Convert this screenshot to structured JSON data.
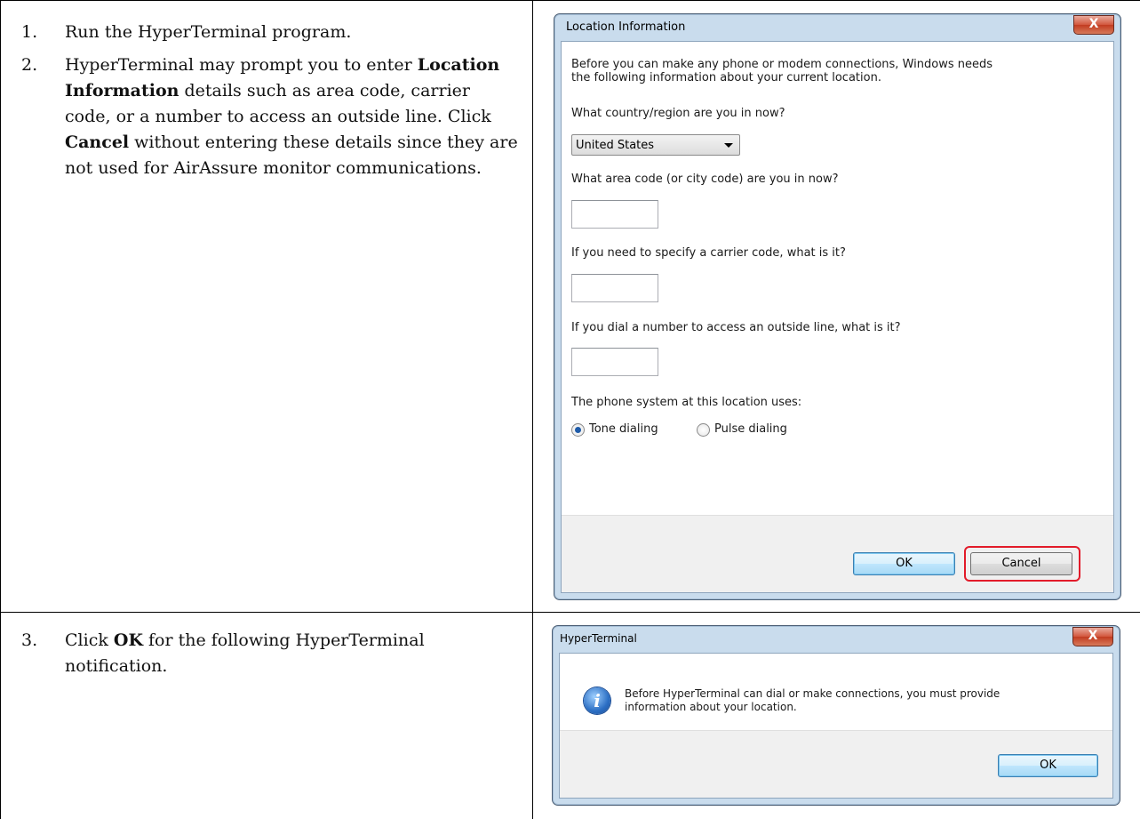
{
  "steps": [
    {
      "number": "1.",
      "text": "Run the HyperTerminal program."
    },
    {
      "number": "2.",
      "t1": "HyperTerminal may prompt you to enter ",
      "b1": "Location Information",
      "t2": " details such as area code, carrier code, or a number to access an outside line. Click ",
      "b2": "Cancel",
      "t3": " without entering these details since they are not used for AirAssure monitor communications."
    },
    {
      "number": "3.",
      "t1": "Click ",
      "b1": "OK",
      "t2": " for the following HyperTerminal notification."
    }
  ],
  "location_dialog": {
    "title": "Location Information",
    "close_glyph": "X",
    "intro_line1": "Before you can make any phone or modem connections, Windows needs",
    "intro_line2": "the following information about your current location.",
    "country_label": "What country/region are you in now?",
    "country_value": "United States",
    "area_code_label": "What area code (or city code) are you in now?",
    "area_code_value": "",
    "carrier_label": "If you need to specify a carrier code, what is it?",
    "carrier_value": "",
    "outside_line_label": "If you dial a number to access an outside line, what is it?",
    "outside_line_value": "",
    "phone_system_label": "The phone system at this location uses:",
    "tone_label": "Tone dialing",
    "pulse_label": "Pulse dialing",
    "selected_dialing": "Tone dialing",
    "ok_label": "OK",
    "cancel_label": "Cancel",
    "highlight_color": "#e21b2a"
  },
  "notification_dialog": {
    "title": "HyperTerminal",
    "close_glyph": "X",
    "icon": "info-icon",
    "message_line1": "Before HyperTerminal can dial or make connections, you must provide",
    "message_line2": "information about your location.",
    "ok_label": "OK"
  }
}
